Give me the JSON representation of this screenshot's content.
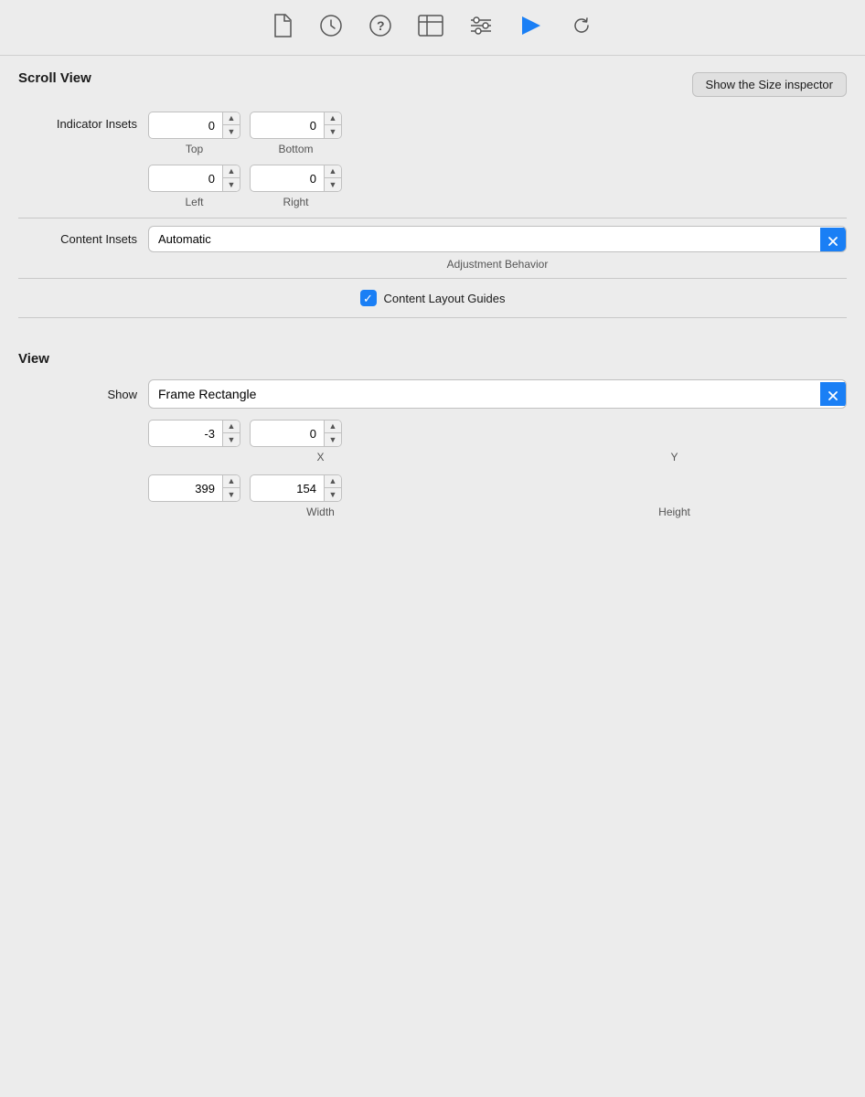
{
  "toolbar": {
    "icons": [
      {
        "name": "document-icon",
        "symbol": "📄",
        "active": false
      },
      {
        "name": "history-icon",
        "symbol": "🕐",
        "active": false
      },
      {
        "name": "help-icon",
        "symbol": "?",
        "active": false
      },
      {
        "name": "inspector-icon",
        "symbol": "⊞",
        "active": false
      },
      {
        "name": "sliders-icon",
        "symbol": "≡",
        "active": false
      },
      {
        "name": "triangle-icon",
        "symbol": "▷",
        "active": true
      },
      {
        "name": "rotate-icon",
        "symbol": "↺",
        "active": false
      }
    ]
  },
  "scroll_view": {
    "title": "Scroll View",
    "show_size_button": "Show the Size inspector",
    "indicator_insets_label": "Indicator Insets",
    "top_value": "0",
    "bottom_value": "0",
    "left_value": "0",
    "right_value": "0",
    "top_label": "Top",
    "bottom_label": "Bottom",
    "left_label": "Left",
    "right_label": "Right",
    "content_insets_label": "Content Insets",
    "content_insets_value": "Automatic",
    "adjustment_behavior_label": "Adjustment Behavior",
    "content_layout_guides_label": "Content Layout Guides",
    "content_layout_guides_checked": true
  },
  "view": {
    "title": "View",
    "show_label": "Show",
    "show_value": "Frame Rectangle",
    "x_value": "-3",
    "y_value": "0",
    "width_value": "399",
    "height_value": "154",
    "x_label": "X",
    "y_label": "Y",
    "width_label": "Width",
    "height_label": "Height"
  }
}
